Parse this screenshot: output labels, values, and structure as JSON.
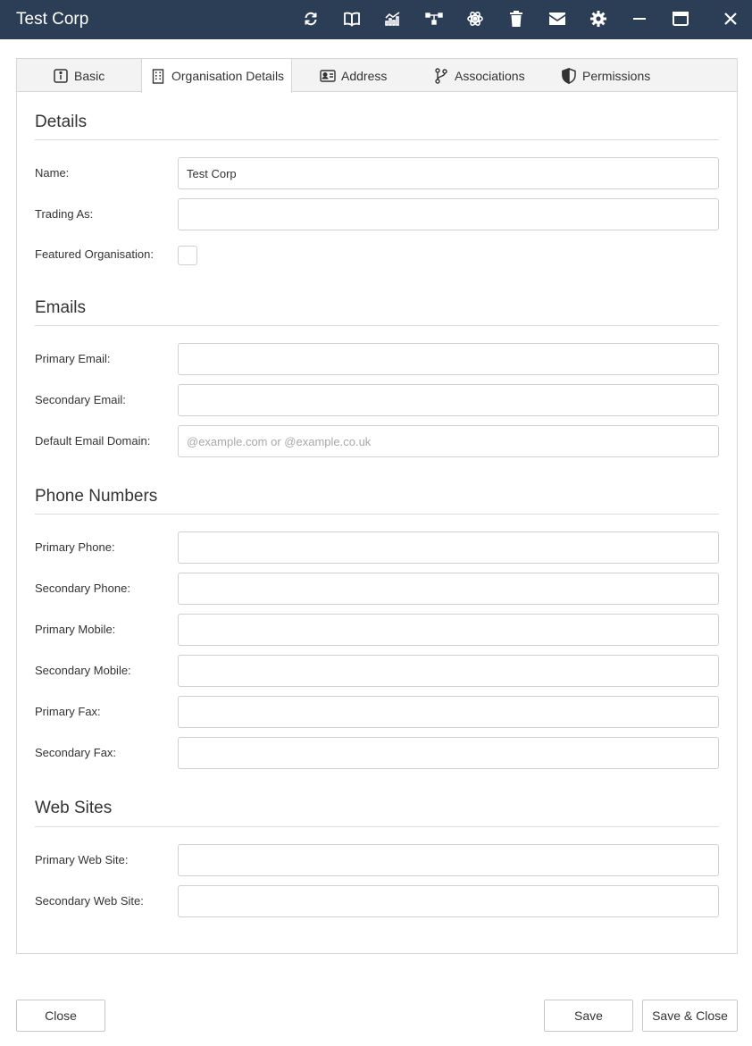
{
  "window": {
    "title": "Test Corp",
    "toolbar_icons": [
      "refresh-icon",
      "book-icon",
      "chart-icon",
      "network-icon",
      "atom-icon",
      "trash-icon",
      "mail-icon",
      "settings-icon",
      "minimize-icon",
      "maximize-icon",
      "close-icon"
    ],
    "titlebar_color": "#2c3e55"
  },
  "tabs": [
    {
      "label": "Basic",
      "icon": "info-icon"
    },
    {
      "label": "Organisation Details",
      "icon": "building-icon",
      "active": true
    },
    {
      "label": "Address",
      "icon": "address-card-icon"
    },
    {
      "label": "Associations",
      "icon": "branch-icon"
    },
    {
      "label": "Permissions",
      "icon": "shield-icon"
    }
  ],
  "details": {
    "heading": "Details",
    "name_label": "Name:",
    "name_value": "Test Corp",
    "trading_as_label": "Trading As:",
    "trading_as_value": "",
    "featured_label": "Featured Organisation:",
    "featured_checked": false
  },
  "emails": {
    "heading": "Emails",
    "primary_label": "Primary Email:",
    "primary_value": "",
    "secondary_label": "Secondary Email:",
    "secondary_value": "",
    "domain_label": "Default Email Domain:",
    "domain_value": "",
    "domain_placeholder": "@example.com or @example.co.uk"
  },
  "phones": {
    "heading": "Phone Numbers",
    "primary_phone_label": "Primary Phone:",
    "secondary_phone_label": "Secondary Phone:",
    "primary_mobile_label": "Primary Mobile:",
    "secondary_mobile_label": "Secondary Mobile:",
    "primary_fax_label": "Primary Fax:",
    "secondary_fax_label": "Secondary Fax:"
  },
  "web": {
    "heading": "Web Sites",
    "primary_label": "Primary Web Site:",
    "secondary_label": "Secondary Web Site:"
  },
  "footer": {
    "close_label": "Close",
    "save_label": "Save",
    "save_close_label": "Save & Close"
  }
}
